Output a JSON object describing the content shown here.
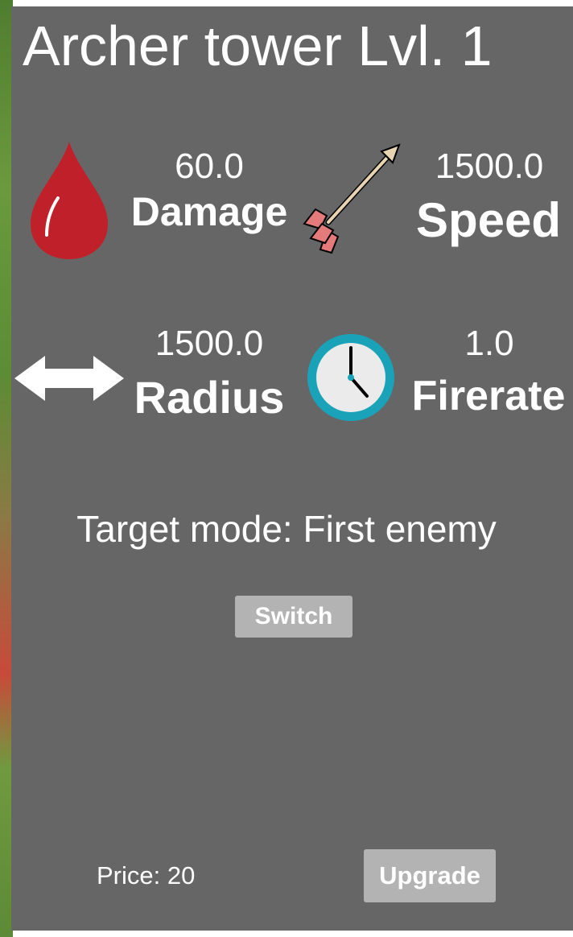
{
  "panel": {
    "title": "Archer tower Lvl. 1",
    "stats": {
      "damage": {
        "value": "60.0",
        "label": "Damage",
        "icon": "blood-drop-icon"
      },
      "speed": {
        "value": "1500.0",
        "label": "Speed",
        "icon": "arrow-icon"
      },
      "radius": {
        "value": "1500.0",
        "label": "Radius",
        "icon": "double-arrow-icon"
      },
      "firerate": {
        "value": "1.0",
        "label": "Firerate",
        "icon": "clock-icon"
      }
    },
    "target_mode": "Target mode: First enemy",
    "switch_label": "Switch",
    "price": "Price: 20",
    "upgrade_label": "Upgrade"
  },
  "colors": {
    "panel": "#666666",
    "button": "#b3b3b3",
    "text": "#ffffff",
    "drop": "#c0202a",
    "clock_rim": "#1aa3b8"
  }
}
